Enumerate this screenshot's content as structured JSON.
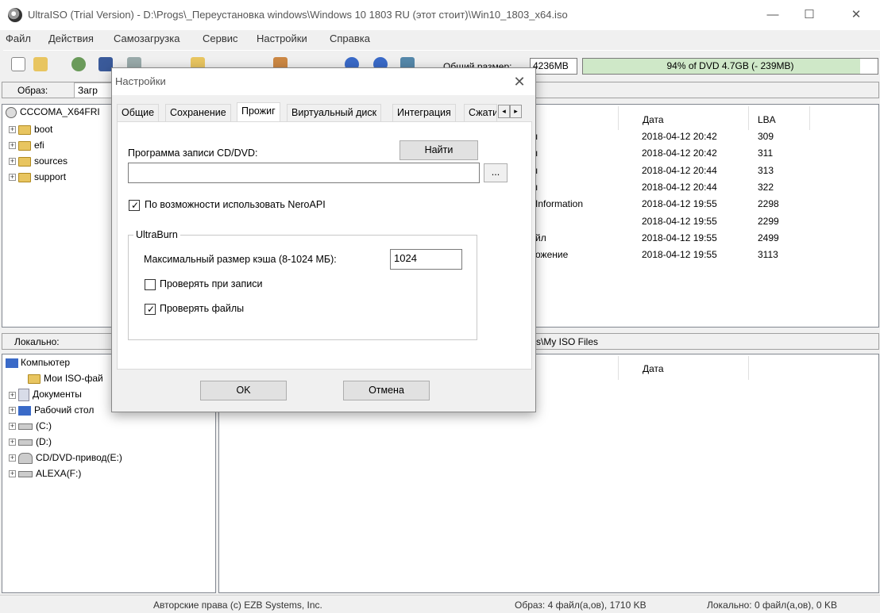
{
  "window": {
    "title": "UltraISO (Trial Version) - D:\\Progs\\_Переустановка windows\\Windows 10 1803 RU (этот стоит)\\Win10_1803_x64.iso",
    "minimize": "—",
    "maximize": "☐",
    "close": "✕"
  },
  "menu": [
    "Файл",
    "Действия",
    "Самозагрузка",
    "Сервис",
    "Настройки",
    "Справка"
  ],
  "toolbar": {
    "size_label": "Общий размер:",
    "size_value": "4236MB",
    "usage_percent": 94,
    "usage_text": "94% of DVD 4.7GB (- 239MB)"
  },
  "image_panel": {
    "label": "Образ:",
    "button": "Загр",
    "tree_root": "CCCOMA_X64FRI",
    "folders": [
      "boot",
      "efi",
      "sources",
      "support"
    ]
  },
  "file_list": {
    "col_date": "Дата",
    "col_lba": "LBA",
    "rows": [
      {
        "name": "ı",
        "date": "2018-04-12 20:42",
        "lba": "309"
      },
      {
        "name": "ı",
        "date": "2018-04-12 20:42",
        "lba": "311"
      },
      {
        "name": "ı",
        "date": "2018-04-12 20:44",
        "lba": "313"
      },
      {
        "name": "ı",
        "date": "2018-04-12 20:44",
        "lba": "322"
      },
      {
        "name": "Information",
        "date": "2018-04-12 19:55",
        "lba": "2298"
      },
      {
        "name": "",
        "date": "2018-04-12 19:55",
        "lba": "2299"
      },
      {
        "name": "йл",
        "date": "2018-04-12 19:55",
        "lba": "2499"
      },
      {
        "name": "ожение",
        "date": "2018-04-12 19:55",
        "lba": "3113"
      }
    ]
  },
  "local_panel": {
    "label": "Локально:",
    "path": "s\\My ISO Files",
    "col_date": "Дата",
    "tree": [
      "Компьютер",
      "Мои ISO-фай",
      "Документы",
      "Рабочий стол",
      "(C:)",
      "(D:)",
      "CD/DVD-привод(E:)",
      "ALEXA(F:)"
    ]
  },
  "status": {
    "copyright": "Авторские права (c) EZB Systems, Inc.",
    "image_info": "Образ: 4 файл(а,ов), 1710 KB",
    "local_info": "Локально: 0 файл(а,ов), 0 KB"
  },
  "dialog": {
    "title": "Настройки",
    "close": "✕",
    "tabs": [
      "Общие",
      "Сохранение",
      "Прожиг",
      "Виртуальный диск",
      "Интеграция",
      "Сжати"
    ],
    "active_tab": "Прожиг",
    "burner_label": "Программа записи CD/DVD:",
    "find_button": "Найти",
    "burner_path": "",
    "browse_button": "...",
    "nero_label": "По возможности использовать NeroAPI",
    "nero_checked": true,
    "group_label": "UltraBurn",
    "cache_label": "Максимальный размер кэша (8-1024 МБ):",
    "cache_value": "1024",
    "verify_write_label": "Проверять при записи",
    "verify_write_checked": false,
    "verify_files_label": "Проверять файлы",
    "verify_files_checked": true,
    "ok_button": "OK",
    "cancel_button": "Отмена"
  }
}
